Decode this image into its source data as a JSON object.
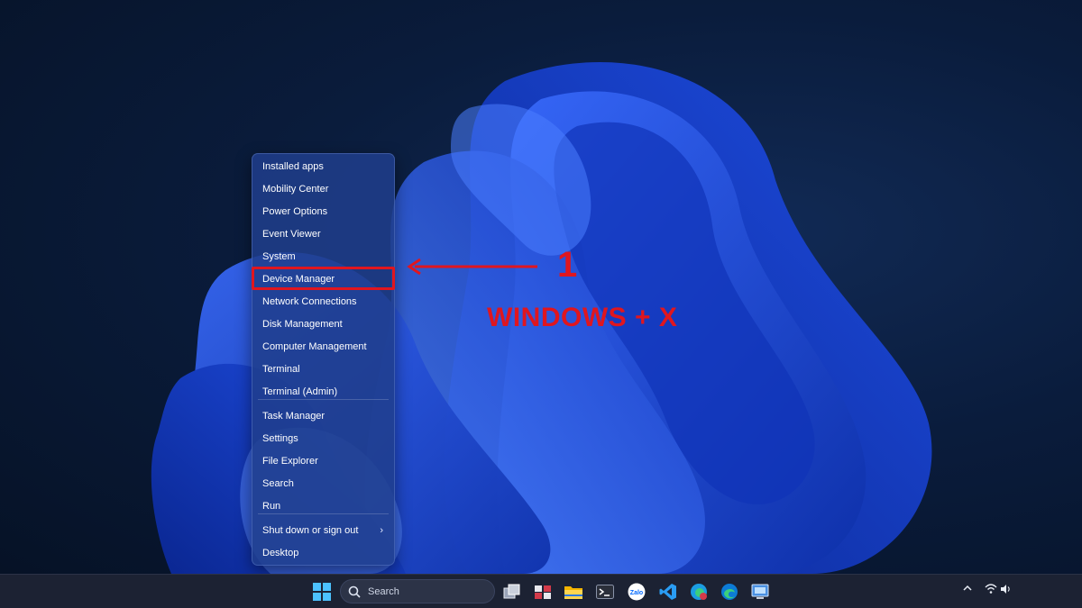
{
  "menu": {
    "items": [
      {
        "label": "Installed apps"
      },
      {
        "label": "Mobility Center"
      },
      {
        "label": "Power Options"
      },
      {
        "label": "Event Viewer"
      },
      {
        "label": "System"
      },
      {
        "label": "Device Manager",
        "highlighted": true
      },
      {
        "label": "Network Connections"
      },
      {
        "label": "Disk Management"
      },
      {
        "label": "Computer Management"
      },
      {
        "label": "Terminal"
      },
      {
        "label": "Terminal (Admin)"
      },
      {
        "label": "Task Manager"
      },
      {
        "label": "Settings"
      },
      {
        "label": "File Explorer"
      },
      {
        "label": "Search"
      },
      {
        "label": "Run"
      },
      {
        "label": "Shut down or sign out",
        "has_submenu": true
      },
      {
        "label": "Desktop"
      }
    ]
  },
  "annotation": {
    "step_number": "1",
    "shortcut": "WINDOWS + X",
    "color": "#e0161f"
  },
  "taskbar": {
    "search_label": "Search",
    "pinned_apps": [
      "start-icon",
      "task-view-icon",
      "windows-tools-icon",
      "file-explorer-icon",
      "terminal-icon",
      "zalo-icon",
      "vscode-icon",
      "edge-beta-icon",
      "edge-icon",
      "screen-capture-icon"
    ],
    "zalo_label": "Zalo",
    "tray_icons": [
      "chevron-up-icon",
      "wifi-icon",
      "volume-icon"
    ]
  },
  "colors": {
    "accent_blue": "#2f5de8",
    "menu_background": "#203e8c",
    "taskbar": "#1c2233"
  }
}
